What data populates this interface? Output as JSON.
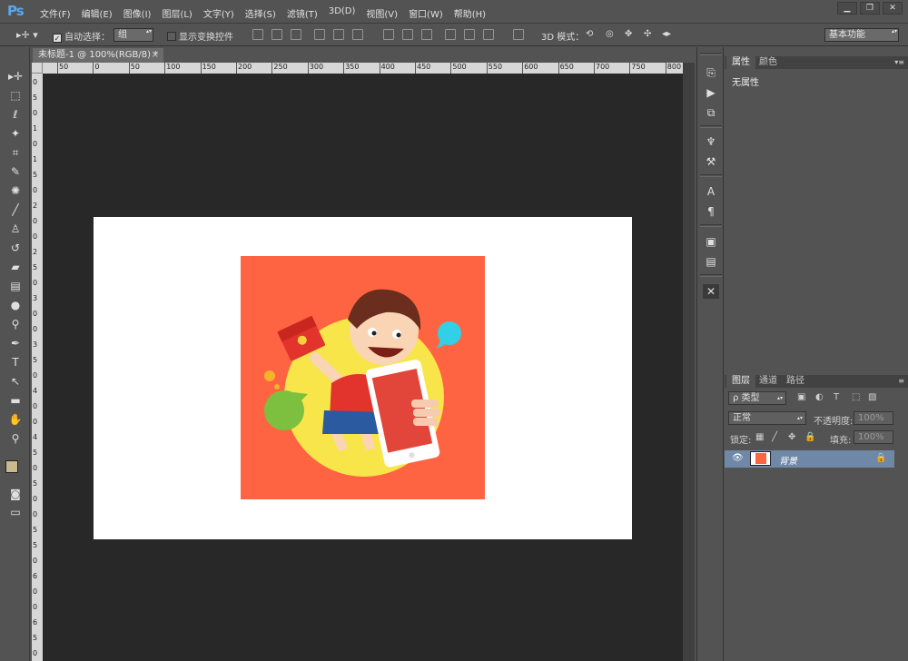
{
  "app": {
    "logo": "Ps"
  },
  "menu": [
    "文件(F)",
    "编辑(E)",
    "图像(I)",
    "图层(L)",
    "文字(Y)",
    "选择(S)",
    "滤镜(T)",
    "3D(D)",
    "视图(V)",
    "窗口(W)",
    "帮助(H)"
  ],
  "window_controls": {
    "minimize": "▁",
    "restore": "❐",
    "close": "✕"
  },
  "options_bar": {
    "auto_select_label": "自动选择：",
    "auto_select_checked": true,
    "auto_select_value": "组",
    "show_transform_label": "显示变换控件",
    "show_transform_checked": false,
    "mode_3d_label": "3D 模式：",
    "workspace_value": "基本功能"
  },
  "document": {
    "tab_title": "未标题-1 @ 100%(RGB/8) *",
    "tab_close": "×",
    "ruler_top_labels": [
      "50",
      "0",
      "50",
      "100",
      "150",
      "200",
      "250",
      "300",
      "350",
      "400",
      "450",
      "500",
      "550",
      "600",
      "650",
      "700",
      "750",
      "800"
    ],
    "ruler_left_labels": [
      "0",
      "5",
      "0",
      "1",
      "0",
      "1",
      "5",
      "0",
      "2",
      "0",
      "0",
      "2",
      "5",
      "0",
      "3",
      "0",
      "0",
      "3",
      "5",
      "0",
      "4",
      "0",
      "0",
      "4",
      "5",
      "0",
      "5",
      "0",
      "0",
      "5",
      "5",
      "0",
      "6",
      "0",
      "0",
      "6",
      "5",
      "0"
    ],
    "canvas_bg": "#282828",
    "artwork_bg": "#ff6442"
  },
  "properties_panel": {
    "tabs": [
      "属性",
      "颜色"
    ],
    "active_tab": "属性",
    "content": "无属性"
  },
  "layers_panel": {
    "tabs": [
      "图层",
      "通道",
      "路径"
    ],
    "active_tab": "图层",
    "filter_label": "ρ 类型",
    "blend_mode": "正常",
    "opacity_label": "不透明度:",
    "opacity_value": "100%",
    "lock_label": "锁定:",
    "fill_label": "填充:",
    "fill_value": "100%",
    "layers": [
      {
        "name": "背景",
        "visible": true,
        "locked": true
      }
    ]
  }
}
